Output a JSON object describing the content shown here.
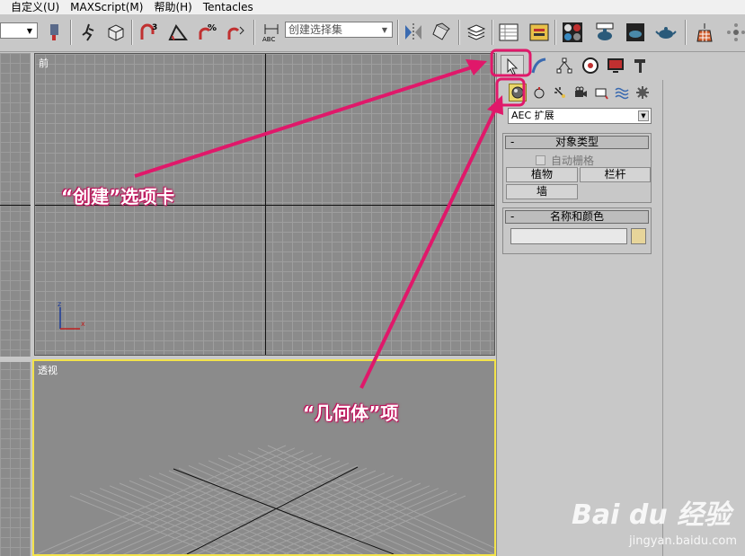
{
  "menu": [
    "自定义(U)",
    "MAXScript(M)",
    "帮助(H)",
    "Tentacles"
  ],
  "toolbar": {
    "selection_set_placeholder": "创建选择集",
    "icons": [
      "pin-icon",
      "walk-icon",
      "cube-icon",
      "snap-3-icon",
      "angle-snap-icon",
      "percent-snap-icon",
      "spinner-snap-icon",
      "abc-edit-icon",
      "mirror-icon",
      "align-icon",
      "layers-icon",
      "curve-editor-icon",
      "schematic-icon",
      "material-editor-icon",
      "render-setup-icon",
      "render-frame-icon",
      "teapot-render-icon",
      "snow-icon",
      "flake-icon"
    ]
  },
  "viewports": {
    "front_label": "前",
    "perspective_label": "透视",
    "gizmo": {
      "z": "z",
      "x": "x"
    }
  },
  "command_panel": {
    "tabs": [
      "create-tab",
      "modify-tab",
      "hierarchy-tab",
      "motion-tab",
      "display-tab",
      "utilities-tab"
    ],
    "sub_icons": [
      "geometry-icon",
      "shapes-icon",
      "lights-icon",
      "cameras-icon",
      "helpers-icon",
      "spacewarps-icon",
      "systems-icon"
    ],
    "category": "AEC 扩展",
    "object_type": {
      "title": "对象类型",
      "collapse": "-",
      "autogrid": "自动栅格",
      "buttons": [
        "植物",
        "栏杆",
        "墙"
      ]
    },
    "name_color": {
      "title": "名称和颜色",
      "collapse": "-",
      "swatch_color": "#e7d59a"
    }
  },
  "annotations": {
    "create_tab": "“创建”选项卡",
    "geometry": "“几何体”项",
    "highlight_color": "#e0186a"
  },
  "watermark": {
    "logo": "Bai du 经验",
    "url": "jingyan.baidu.com"
  }
}
